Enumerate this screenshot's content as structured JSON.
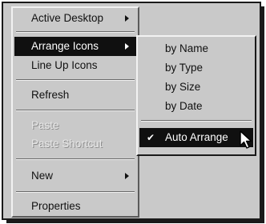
{
  "context_menu": {
    "items": [
      {
        "label": "Active Desktop",
        "has_submenu": true,
        "state": "normal"
      },
      {
        "label": "Arrange Icons",
        "has_submenu": true,
        "state": "highlighted"
      },
      {
        "label": "Line Up Icons",
        "has_submenu": false,
        "state": "normal"
      },
      {
        "label": "Refresh",
        "has_submenu": false,
        "state": "normal"
      },
      {
        "label": "Paste",
        "has_submenu": false,
        "state": "disabled"
      },
      {
        "label": "Paste Shortcut",
        "has_submenu": false,
        "state": "disabled"
      },
      {
        "label": "New",
        "has_submenu": true,
        "state": "normal"
      },
      {
        "label": "Properties",
        "has_submenu": false,
        "state": "normal"
      }
    ]
  },
  "arrange_submenu": {
    "items": [
      {
        "label": "by Name"
      },
      {
        "label": "by Type"
      },
      {
        "label": "by Size"
      },
      {
        "label": "by Date"
      },
      {
        "label": "Auto Arrange",
        "checked": true,
        "state": "highlighted"
      }
    ],
    "check_glyph": "✔"
  },
  "colors": {
    "menu_face": "#c9c9c9",
    "highlight": "#101010",
    "highlight_text": "#ffffff"
  }
}
